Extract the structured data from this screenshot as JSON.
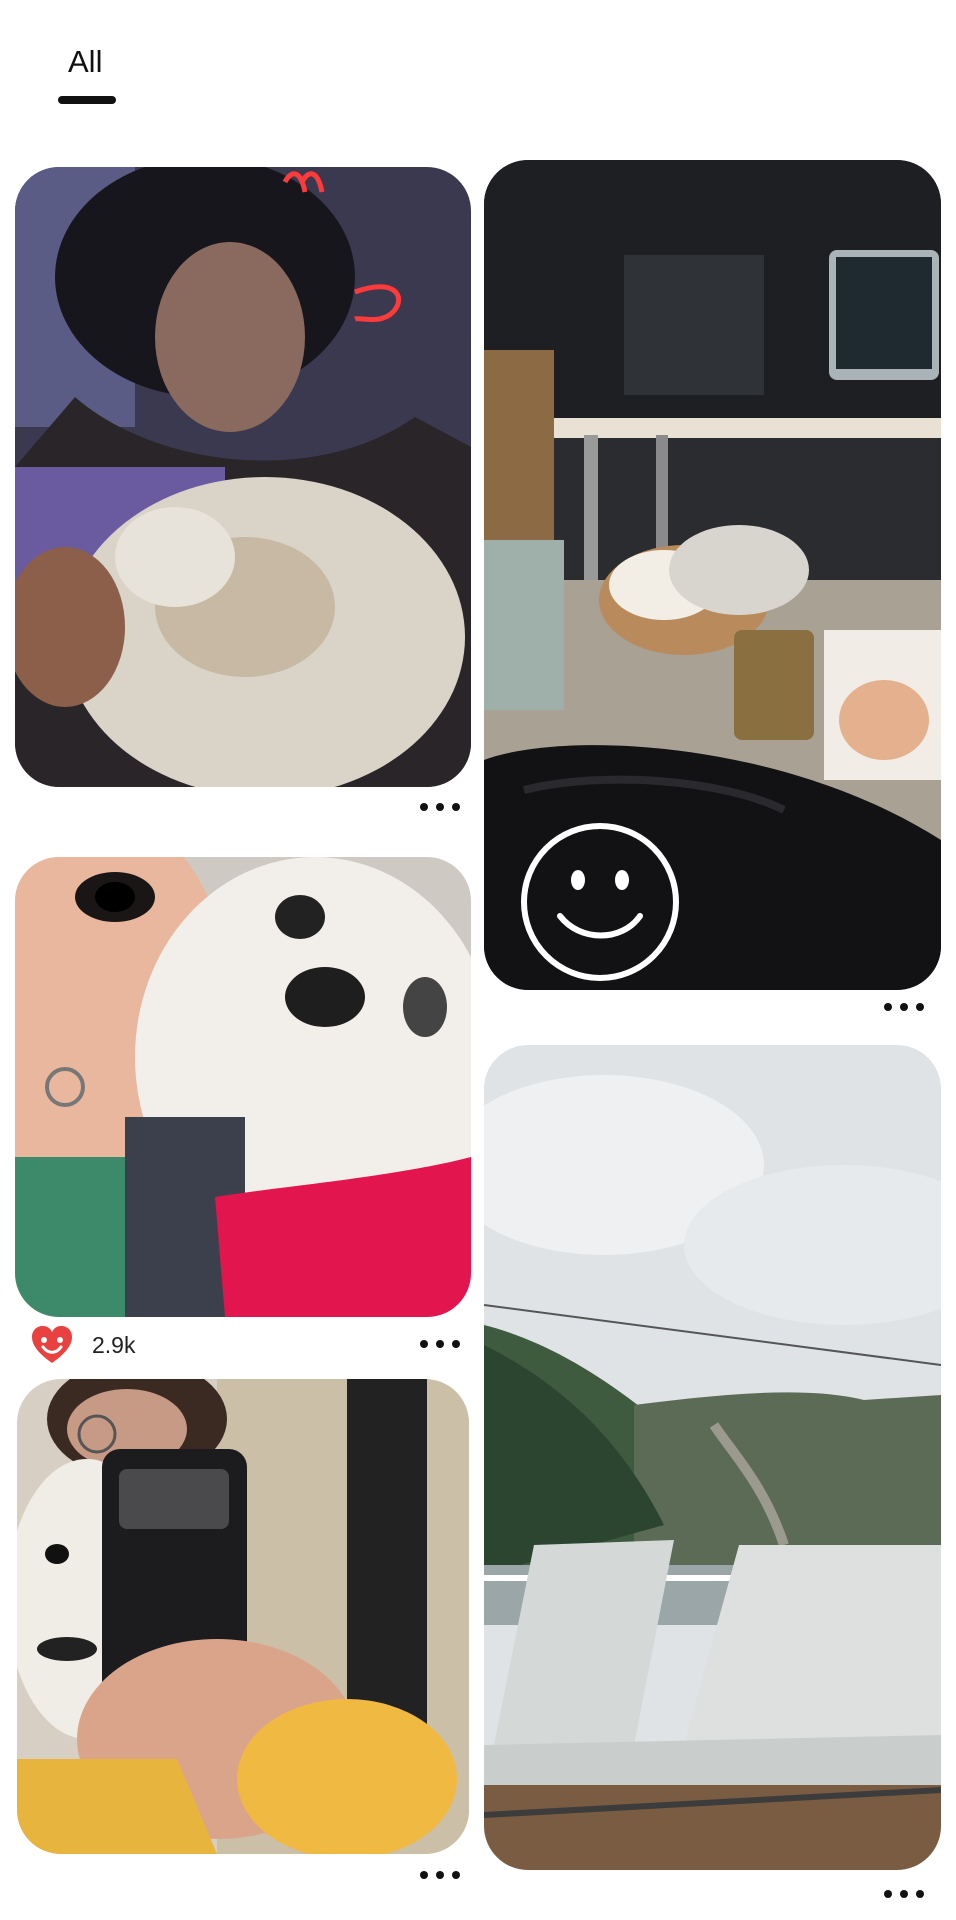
{
  "tabs": [
    {
      "label": "All",
      "selected": true
    }
  ],
  "pins": [
    {
      "name": "pin-selfie-with-dog-neon",
      "description_icon": "photo"
    },
    {
      "name": "pin-room-with-dog-bed"
    },
    {
      "name": "pin-face-with-dog-sweater",
      "reaction_count": "2.9k",
      "reaction_icon": "heart-face-icon"
    },
    {
      "name": "pin-mountains-deck-chairs"
    },
    {
      "name": "pin-mirror-selfie-dog"
    }
  ],
  "colors": {
    "reaction_heart": "#e8413f",
    "text": "#111111"
  }
}
